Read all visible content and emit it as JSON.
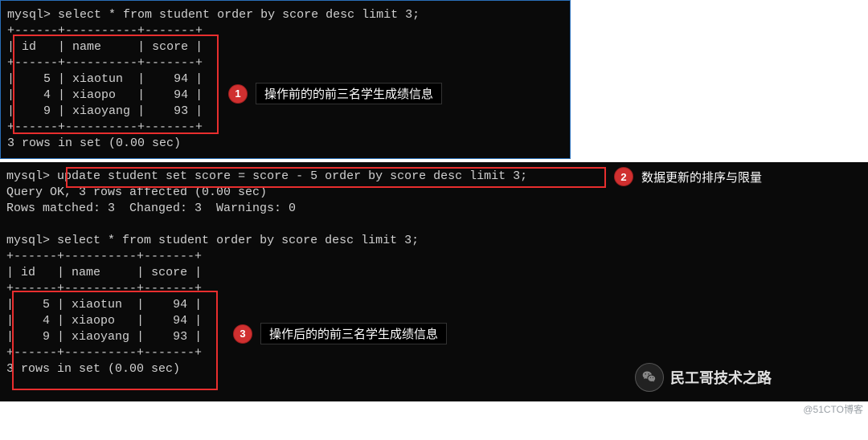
{
  "terminal1": {
    "prompt": "mysql>",
    "query1": "select * from student order by score desc limit 3;",
    "headers": {
      "c1": "id",
      "c2": "name",
      "c3": "score"
    },
    "rows": [
      {
        "id": "5",
        "name": "xiaotun",
        "score": "94"
      },
      {
        "id": "4",
        "name": "xiaopo",
        "score": "94"
      },
      {
        "id": "9",
        "name": "xiaoyang",
        "score": "93"
      }
    ],
    "result": "3 rows in set (0.00 sec)"
  },
  "terminal2": {
    "prompt": "mysql>",
    "update_query": "update student set score = score - 5 order by score desc limit 3;",
    "update_result1": "Query OK, 3 rows affected (0.00 sec)",
    "update_result2": "Rows matched: 3  Changed: 3  Warnings: 0",
    "query2": "select * from student order by score desc limit 3;",
    "headers": {
      "c1": "id",
      "c2": "name",
      "c3": "score"
    },
    "rows": [
      {
        "id": "5",
        "name": "xiaotun",
        "score": "94"
      },
      {
        "id": "4",
        "name": "xiaopo",
        "score": "94"
      },
      {
        "id": "9",
        "name": "xiaoyang",
        "score": "93"
      }
    ],
    "result": "3 rows in set (0.00 sec)"
  },
  "annotations": {
    "a1": {
      "num": "1",
      "text": "操作前的的前三名学生成绩信息"
    },
    "a2": {
      "num": "2",
      "text": "数据更新的排序与限量"
    },
    "a3": {
      "num": "3",
      "text": "操作后的的前三名学生成绩信息"
    }
  },
  "watermark": {
    "text": "民工哥技术之路",
    "sub": "@51CTO博客"
  }
}
